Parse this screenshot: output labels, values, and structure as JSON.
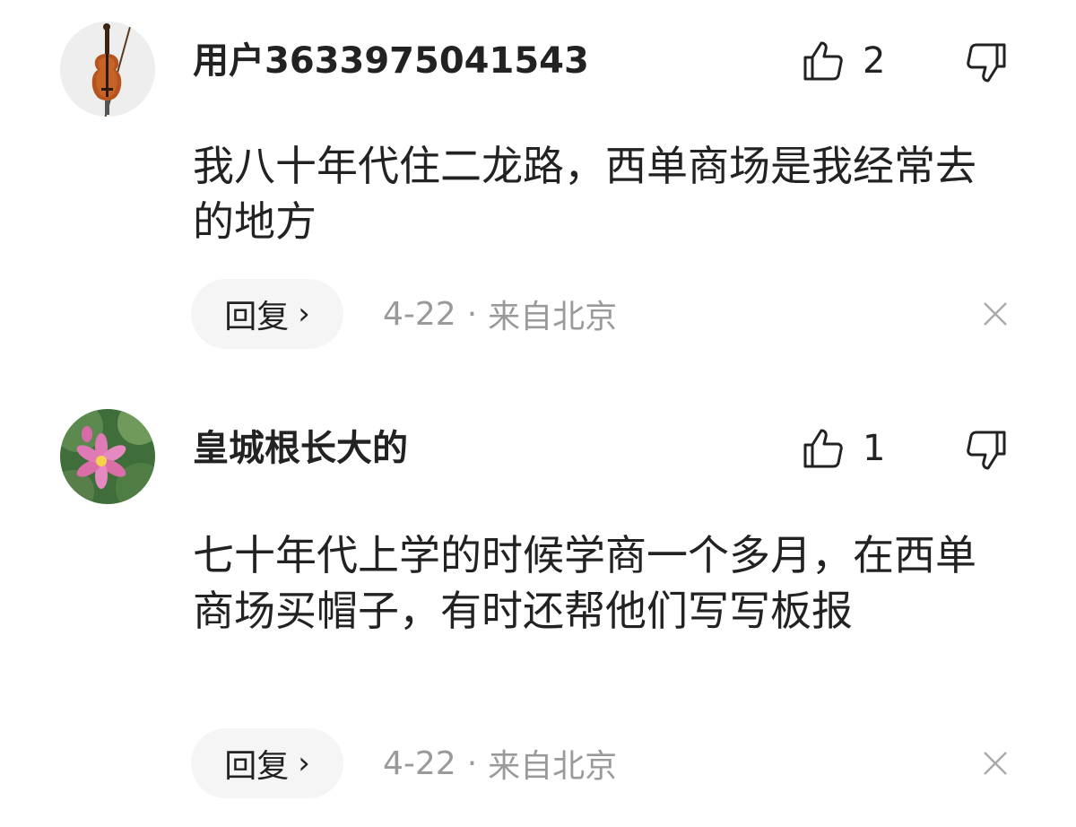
{
  "comments": [
    {
      "avatar": "cello-icon",
      "username": "用户3633975041543",
      "likes": "2",
      "text": "我八十年代住二龙路，西单商场是我经常去的地方",
      "reply_label": "回复",
      "date": "4-22",
      "separator": "·",
      "location": "来自北京"
    },
    {
      "avatar": "lotus-flower-icon",
      "username": "皇城根长大的",
      "likes": "1",
      "text": "七十年代上学的时候学商一个多月，在西单商场买帽子，有时还帮他们写写板报",
      "reply_label": "回复",
      "date": "4-22",
      "separator": "·",
      "location": "来自北京"
    }
  ],
  "colors": {
    "text": "#222222",
    "meta": "#9a9a9a",
    "reply_bg": "#f5f5f5"
  },
  "icons": {
    "like": "thumbs-up-icon",
    "dislike": "thumbs-down-icon",
    "close": "close-icon",
    "chevron": "chevron-right-icon"
  }
}
